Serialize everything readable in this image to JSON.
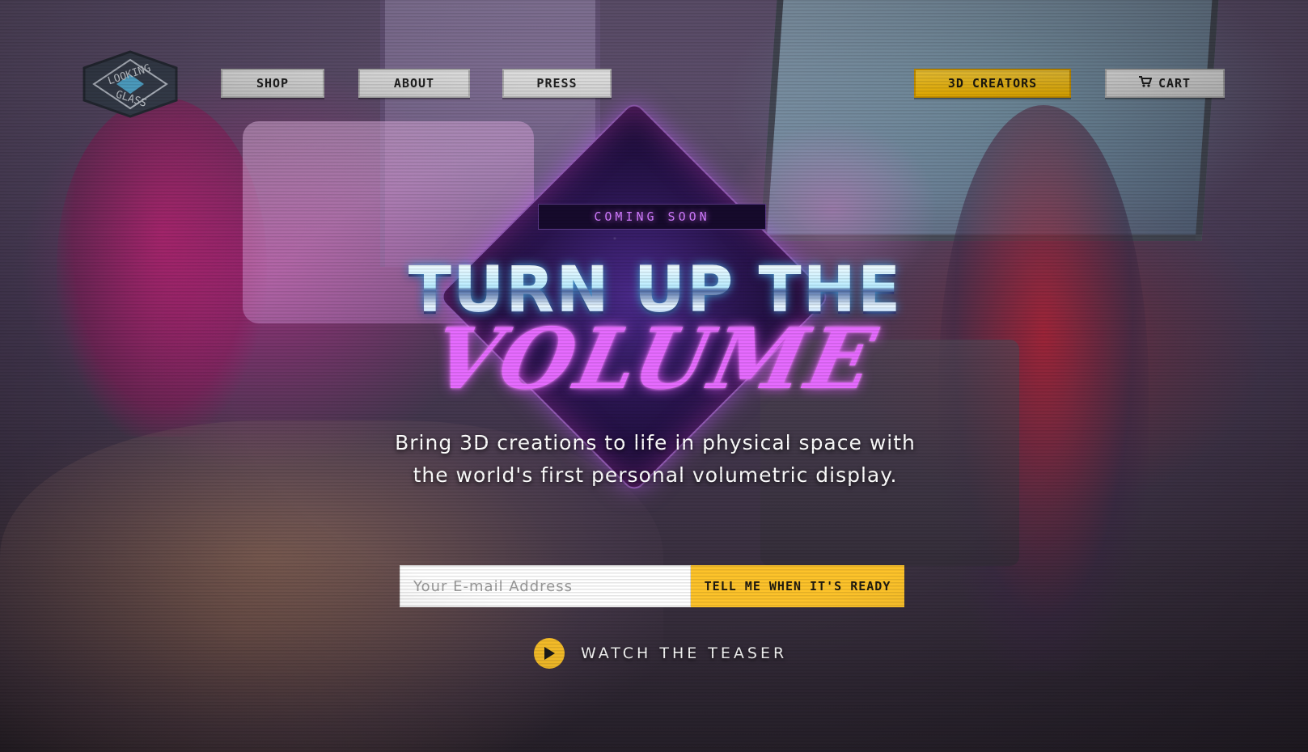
{
  "logo": {
    "line1": "LOOKING",
    "line2": "GLASS"
  },
  "nav": {
    "shop": "SHOP",
    "about": "ABOUT",
    "press": "PRESS",
    "creators": "3D CREATORS",
    "cart": "CART"
  },
  "hero": {
    "badge": "COMING SOON",
    "headline_top": "TURN UP THE",
    "headline_bottom": "VOLUME",
    "subtitle_line1": "Bring 3D creations to life in physical space with",
    "subtitle_line2": "the world's first personal volumetric display."
  },
  "signup": {
    "email_placeholder": "Your E-mail Address",
    "button_label": "TELL ME WHEN IT'S READY"
  },
  "teaser": {
    "label": "WATCH THE TEASER"
  },
  "colors": {
    "accent_yellow": "#fdc32a",
    "neon_purple": "#e66bff",
    "neon_cyan": "#b8ecff"
  },
  "icons": {
    "logo": "looking-glass-logo",
    "cart": "cart-icon",
    "play": "play-icon"
  }
}
